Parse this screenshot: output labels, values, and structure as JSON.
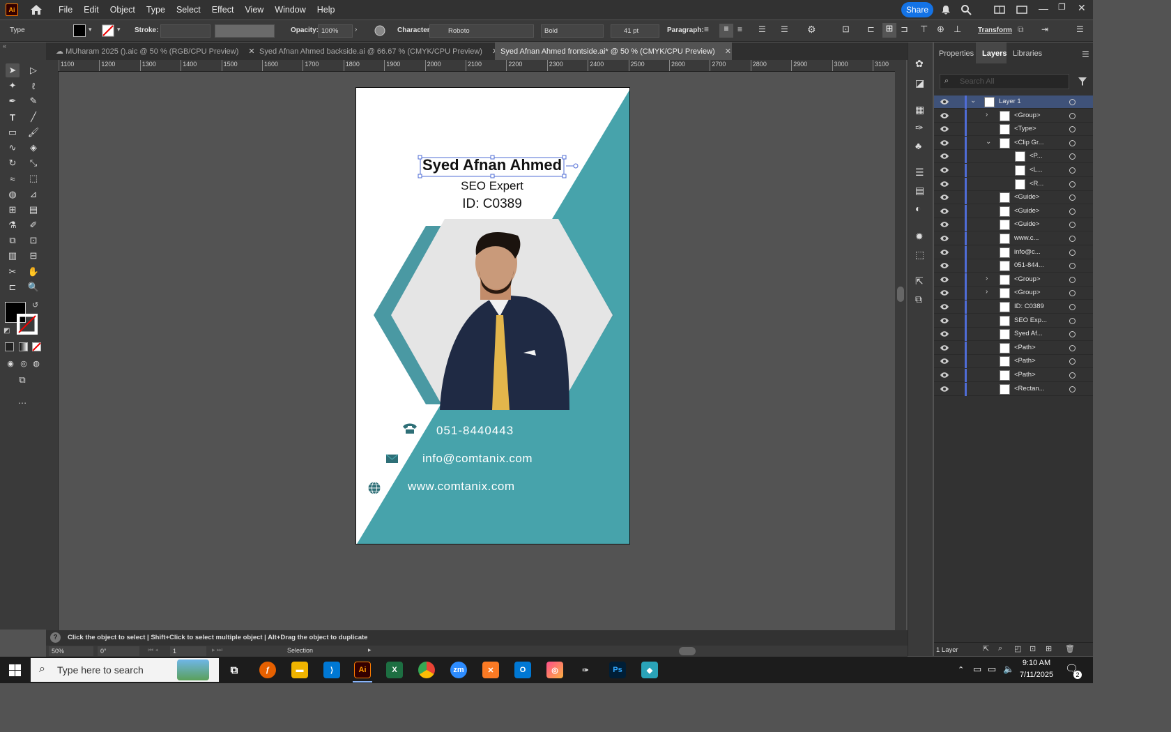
{
  "app": {
    "logo": "Ai",
    "name": "Adobe Illustrator"
  },
  "menus": [
    "File",
    "Edit",
    "Object",
    "Type",
    "Select",
    "Effect",
    "View",
    "Window",
    "Help"
  ],
  "share_label": "Share",
  "control": {
    "type_label": "Type",
    "stroke_label": "Stroke:",
    "opacity_label": "Opacity:",
    "opacity_value": "100%",
    "character_label": "Character:",
    "font_family": "Roboto",
    "font_style": "Bold",
    "font_size": "41 pt",
    "paragraph_label": "Paragraph:",
    "transform_label": "Transform"
  },
  "tabs": [
    {
      "label": "MUharam 2025 ().aic @ 50 % (RGB/CPU Preview)",
      "active": false
    },
    {
      "label": "Syed Afnan Ahmed backside.ai @ 66.67 % (CMYK/CPU Preview)",
      "active": false
    },
    {
      "label": "Syed Afnan Ahmed frontside.ai* @ 50 % (CMYK/CPU Preview)",
      "active": true
    }
  ],
  "ruler_h": [
    "1100",
    "1200",
    "1300",
    "1400",
    "1500",
    "1600",
    "1700",
    "1800",
    "1900",
    "2000",
    "2100",
    "2200",
    "2300",
    "2400",
    "2500",
    "2600",
    "2700",
    "2800",
    "2900",
    "3000",
    "3100"
  ],
  "card": {
    "name": "Syed Afnan Ahmed",
    "title": "SEO Expert",
    "id": "ID: C0389",
    "phone": "051-8440443",
    "email": "info@comtanix.com",
    "web": "www.comtanix.com",
    "teal": "#47a3ab"
  },
  "panel": {
    "tabs": [
      "Properties",
      "Layers",
      "Libraries"
    ],
    "active_tab": "Layers",
    "search_placeholder": "Search All",
    "layers": [
      {
        "name": "Layer 1",
        "indent": 0,
        "arrow": "v"
      },
      {
        "name": "<Group>",
        "indent": 1,
        "arrow": ">"
      },
      {
        "name": "<Type>",
        "indent": 1,
        "arrow": ""
      },
      {
        "name": "<Clip Gr...",
        "indent": 1,
        "arrow": "v"
      },
      {
        "name": "<P...",
        "indent": 2,
        "arrow": ""
      },
      {
        "name": "<L...",
        "indent": 2,
        "arrow": ""
      },
      {
        "name": "<R...",
        "indent": 2,
        "arrow": ""
      },
      {
        "name": "<Guide>",
        "indent": 1,
        "arrow": ""
      },
      {
        "name": "<Guide>",
        "indent": 1,
        "arrow": ""
      },
      {
        "name": "<Guide>",
        "indent": 1,
        "arrow": ""
      },
      {
        "name": "www.c...",
        "indent": 1,
        "arrow": ""
      },
      {
        "name": "info@c...",
        "indent": 1,
        "arrow": ""
      },
      {
        "name": "051-844...",
        "indent": 1,
        "arrow": ""
      },
      {
        "name": "<Group>",
        "indent": 1,
        "arrow": ">"
      },
      {
        "name": "<Group>",
        "indent": 1,
        "arrow": ">"
      },
      {
        "name": "ID: C0389",
        "indent": 1,
        "arrow": ""
      },
      {
        "name": "SEO Exp...",
        "indent": 1,
        "arrow": ""
      },
      {
        "name": "Syed Af...",
        "indent": 1,
        "arrow": ""
      },
      {
        "name": "<Path>",
        "indent": 1,
        "arrow": ""
      },
      {
        "name": "<Path>",
        "indent": 1,
        "arrow": ""
      },
      {
        "name": "<Path>",
        "indent": 1,
        "arrow": ""
      },
      {
        "name": "<Rectan...",
        "indent": 1,
        "arrow": ""
      }
    ],
    "footer": "1 Layer"
  },
  "status": {
    "hint": "Click the object to select  |  Shift+Click to select multiple object  |  Alt+Drag the object to duplicate",
    "zoom": "50%",
    "rotation": "0°",
    "artboard": "1",
    "tool": "Selection"
  },
  "taskbar": {
    "search_placeholder": "Type here to search",
    "time": "9:10 AM",
    "date": "7/11/2025",
    "notif_count": "2"
  }
}
